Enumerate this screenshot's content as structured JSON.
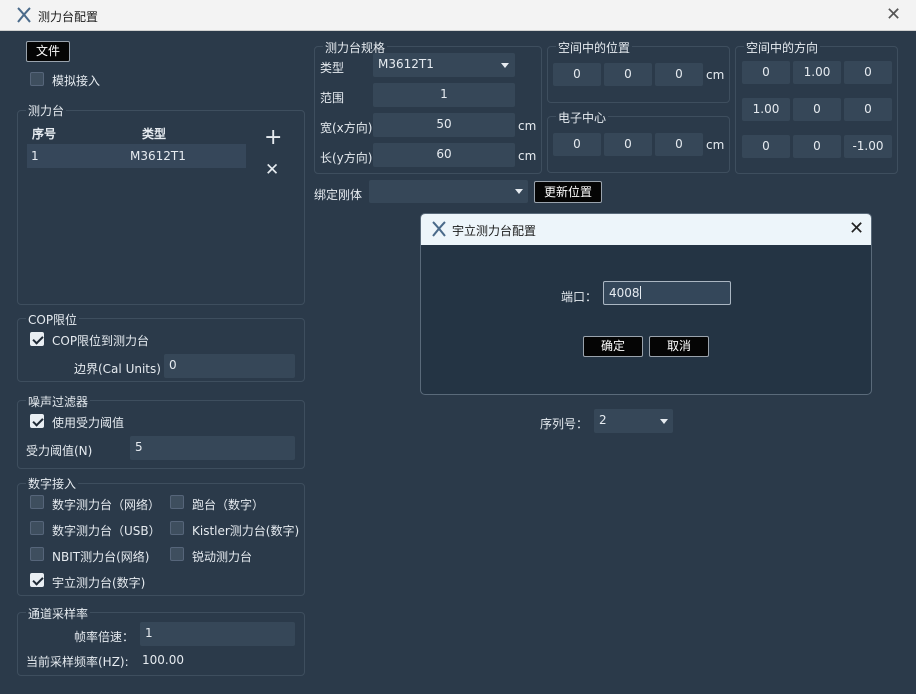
{
  "window": {
    "title": "测力台配置",
    "close": "✕"
  },
  "file_button": "文件",
  "simulate_access": {
    "label": "模拟接入",
    "checked": false
  },
  "plates_group": {
    "title": "测力台",
    "columns": [
      "序号",
      "类型"
    ],
    "rows": [
      {
        "index": "1",
        "type": "M3612T1"
      }
    ],
    "add": "+",
    "remove": "✕"
  },
  "cop_group": {
    "title": "COP限位",
    "checkbox": "COP限位到测力台",
    "checked": true,
    "boundary_label": "边界(Cal Units)",
    "boundary_value": "0"
  },
  "noise_group": {
    "title": "噪声过滤器",
    "checkbox": "使用受力阈值",
    "checked": true,
    "threshold_label": "受力阈值(N)",
    "threshold_value": "5"
  },
  "digital_group": {
    "title": "数字接入",
    "options": [
      {
        "label": "数字测力台（网络）",
        "checked": false,
        "enabled": false
      },
      {
        "label": "跑台（数字）",
        "checked": false,
        "enabled": false
      },
      {
        "label": "数字测力台（USB）",
        "checked": false,
        "enabled": false
      },
      {
        "label": "Kistler测力台(数字)",
        "checked": false,
        "enabled": false
      },
      {
        "label": "NBIT测力台(网络)",
        "checked": false,
        "enabled": false
      },
      {
        "label": "锐动测力台",
        "checked": false,
        "enabled": false
      },
      {
        "label": "宇立测力台(数字)",
        "checked": true,
        "enabled": true
      }
    ]
  },
  "sampling_group": {
    "title": "通道采样率",
    "rate_multiplier_label": "帧率倍速：",
    "rate_multiplier_value": "1",
    "current_rate_label": "当前采样频率(HZ):",
    "current_rate_value": "100.00"
  },
  "spec_group": {
    "title": "测力台规格",
    "type_label": "类型",
    "type_value": "M3612T1",
    "range_label": "范围",
    "range_value": "1",
    "width_label": "宽(x方向)",
    "width_value": "50",
    "width_unit": "cm",
    "length_label": "长(y方向)",
    "length_value": "60",
    "length_unit": "cm"
  },
  "position_group": {
    "title": "空间中的位置",
    "values": [
      "0",
      "0",
      "0"
    ],
    "unit": "cm"
  },
  "electric_center_group": {
    "title": "电子中心",
    "values": [
      "0",
      "0",
      "0"
    ],
    "unit": "cm"
  },
  "orientation_group": {
    "title": "空间中的方向",
    "values": [
      "0",
      "1.00",
      "0",
      "1.00",
      "0",
      "0",
      "0",
      "0",
      "-1.00"
    ]
  },
  "bind_rigid": {
    "label": "绑定刚体",
    "value": ""
  },
  "update_position_button": "更新位置",
  "serial": {
    "label": "序列号：",
    "value": "2"
  },
  "dialog": {
    "title": "宇立测力台配置",
    "port_label": "端口：",
    "port_value": "4008",
    "ok": "确定",
    "cancel": "取消",
    "close": "✕"
  }
}
